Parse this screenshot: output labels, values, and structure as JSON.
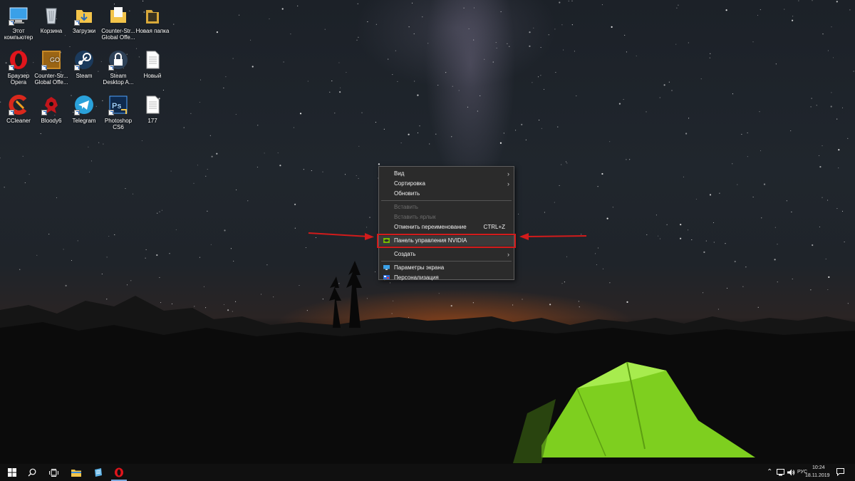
{
  "desktop": {
    "icons": [
      {
        "label": "Этот компьютер",
        "icon": "this-pc-icon"
      },
      {
        "label": "Корзина",
        "icon": "recycle-bin-icon"
      },
      {
        "label": "Загрузки",
        "icon": "folder-downloads-icon"
      },
      {
        "label": "Counter-Str... Global Offe...",
        "icon": "folder-icon"
      },
      {
        "label": "Новая папка",
        "icon": "folder-icon"
      },
      {
        "label": "Браузер Opera",
        "icon": "opera-icon"
      },
      {
        "label": "Counter-Str... Global Offe...",
        "icon": "csgo-icon"
      },
      {
        "label": "Steam",
        "icon": "steam-icon"
      },
      {
        "label": "Steam Desktop A...",
        "icon": "steam-authenticator-icon"
      },
      {
        "label": "Новый",
        "icon": "text-file-icon"
      },
      {
        "label": "CCleaner",
        "icon": "ccleaner-icon"
      },
      {
        "label": "Bloody6",
        "icon": "bloody-icon"
      },
      {
        "label": "Telegram",
        "icon": "telegram-icon"
      },
      {
        "label": "Photoshop CS6",
        "icon": "photoshop-icon"
      },
      {
        "label": "177",
        "icon": "text-file-icon"
      }
    ]
  },
  "context_menu": {
    "view": "Вид",
    "sort": "Сортировка",
    "refresh": "Обновить",
    "paste": "Вставить",
    "paste_shortcut": "Вставить ярлык",
    "undo_rename": "Отменить переименование",
    "undo_shortcut": "CTRL+Z",
    "nvidia": "Панель управления NVIDIA",
    "create": "Создать",
    "display_settings": "Параметры экрана",
    "personalization": "Персонализация"
  },
  "taskbar": {
    "language": "РУС",
    "time": "10:24",
    "date": "18.11.2019"
  },
  "colors": {
    "highlight_red": "#d21b1b",
    "nvidia_green": "#76b900"
  }
}
